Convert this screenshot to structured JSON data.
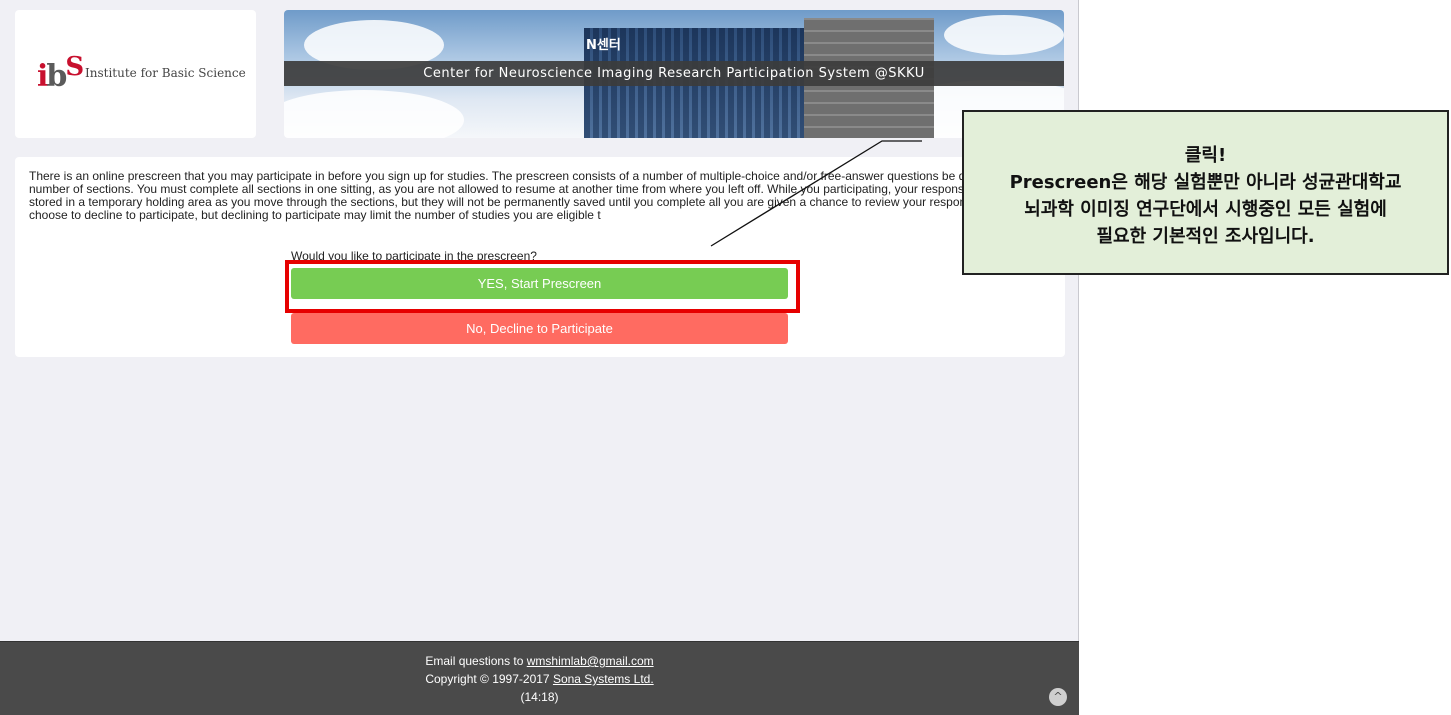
{
  "header": {
    "logo_mark": {
      "i": "i",
      "b": "b",
      "s": "S"
    },
    "logo_text": "Institute for Basic Science",
    "banner_title": "Center for Neuroscience Imaging Research Participation System @SKKU",
    "building_sign": "N센터"
  },
  "prescreen": {
    "description": "There is an online prescreen that you may participate in before you sign up for studies. The prescreen consists of a number of multiple-choice and/or free-answer questions be divided into a number of sections. You must complete all sections in one sitting, as you are not allowed to resume at another time from where you left off. While you participating, your responses will be stored in a temporary holding area as you move through the sections, but they will not be permanently saved until you complete all you are given a chance to review your responses. You may choose to decline to participate, but declining to participate may limit the number of studies you are eligible t",
    "question": "Would you like to participate in the prescreen?",
    "yes_label": "YES, Start Prescreen",
    "no_label": "No, Decline to Participate"
  },
  "footer": {
    "email_prefix": "Email questions to ",
    "email": "wmshimlab@gmail.com",
    "copyright_prefix": "Copyright © 1997-2017 ",
    "company": "Sona Systems Ltd.",
    "time": "(14:18)",
    "scroll_top_icon": "^"
  },
  "annotation": {
    "line1": "클릭!",
    "line2": "Prescreen은 해당 실험뿐만 아니라 성균관대학교",
    "line3": "뇌과학 이미징 연구단에서 시행중인 모든 실험에",
    "line4": "필요한 기본적인 조사입니다."
  },
  "colors": {
    "yes_button": "#77cc53",
    "no_button": "#ff6b61",
    "highlight": "#e60000",
    "callout_bg": "#e3efd9",
    "footer_bg": "#4a4a4a"
  }
}
